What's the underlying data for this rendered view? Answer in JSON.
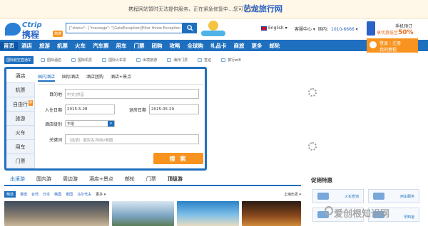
{
  "notice": {
    "text": "携程网站暂时无法提供服务，正在紧急修复中…您可以访问：",
    "brand": "艺龙旅行网"
  },
  "header": {
    "logo_en": "Ctrip",
    "logo_cn": "携程",
    "hot_badge": "热搜",
    "search_placeholder": "{\"status\": {\"message\": \"[GateException]Filter threw Exception",
    "lang": "English",
    "service": "客服中心",
    "hotline_label": "国内：",
    "hotline_number": "1010-6666",
    "mobile_title": "手机预订",
    "mobile_promo_prefix": "享优惠低至",
    "mobile_promo_value": "50%"
  },
  "mainnav": {
    "items": [
      "首页",
      "酒店",
      "旅游",
      "机票",
      "火车",
      "汽车票",
      "用车",
      "门票",
      "团购",
      "攻略",
      "全球购",
      "礼品卡",
      "商旅",
      "更多",
      "邮轮"
    ],
    "login_top": "登录｜注册",
    "login_bottom": "我的携程"
  },
  "subnav": {
    "tag": "国际航空直通车",
    "links": [
      "国际酒店",
      "国际机票",
      "国际火车票",
      "出境旅游",
      "海外门票",
      "签证",
      "旅行wifi"
    ]
  },
  "booking": {
    "vtabs": [
      "酒店",
      "机票",
      "自由行",
      "旅游",
      "火车",
      "用车",
      "门票"
    ],
    "badge": "惠",
    "htabs": [
      "国内酒店",
      "国际酒店",
      "酒店团购",
      "酒店+景点"
    ],
    "destination_label": "目的地",
    "destination_placeholder": "中文/拼音",
    "checkin_label": "入住日期",
    "checkin_value": "2015-5-28",
    "checkout_label": "退房日期",
    "checkout_value": "2015-05-29",
    "level_label": "酒店级别",
    "level_value": "不限",
    "keyword_label": "关键词",
    "keyword_placeholder": "（选填）酒店名/地标/商圈",
    "search_button": "搜 索"
  },
  "products": {
    "tabs": [
      "出境游",
      "国内游",
      "周边游",
      "酒店+景点",
      "邮轮",
      "门票",
      "顶级游"
    ],
    "filters": [
      "精选",
      "港澳",
      "台湾",
      "日本",
      "韩国",
      "泰国",
      "马尔代夫"
    ],
    "more": "更多",
    "city": "上海出发"
  },
  "promo": {
    "title": "促销特惠",
    "cards": [
      "火车查询",
      "用车服务",
      "",
      "早知道"
    ]
  },
  "watermark": "爱创根知识网",
  "colors": {
    "primary": "#1f6fbf",
    "accent": "#f7931e",
    "notice_bg": "#fff7e8"
  }
}
